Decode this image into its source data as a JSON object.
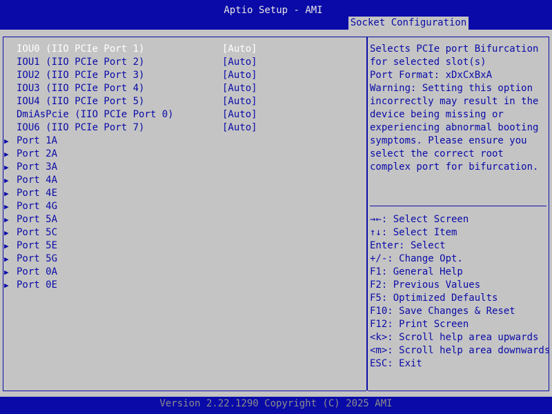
{
  "header": {
    "title": "Aptio Setup - AMI",
    "active_tab": "Socket Configuration"
  },
  "options": [
    {
      "label": "IOU0 (IIO PCIe Port 1)",
      "value": "[Auto]"
    },
    {
      "label": "IOU1 (IIO PCIe Port 2)",
      "value": "[Auto]"
    },
    {
      "label": "IOU2 (IIO PCIe Port 3)",
      "value": "[Auto]"
    },
    {
      "label": "IOU3 (IIO PCIe Port 4)",
      "value": "[Auto]"
    },
    {
      "label": "IOU4 (IIO PCIe Port 5)",
      "value": "[Auto]"
    },
    {
      "label": "DmiAsPcie (IIO PCIe Port 0)",
      "value": "[Auto]"
    },
    {
      "label": "IOU6 (IIO PCIe Port 7)",
      "value": "[Auto]"
    }
  ],
  "submenus": [
    "Port 1A",
    "Port 2A",
    "Port 3A",
    "Port 4A",
    "Port 4E",
    "Port 4G",
    "Port 5A",
    "Port 5C",
    "Port 5E",
    "Port 5G",
    "Port 0A",
    "Port 0E"
  ],
  "submenu_arrow_icon": "right-triangle-icon",
  "help_text": [
    "Selects PCIe port Bifurcation",
    "for selected slot(s)",
    "Port Format: xDxCxBxA",
    "Warning: Setting this option",
    "incorrectly may result in the",
    "device being missing or",
    "experiencing abnormal booting",
    "symptoms. Please ensure you",
    "select the correct root",
    "complex port for bifurcation."
  ],
  "key_help": [
    "→←: Select Screen",
    "↑↓: Select Item",
    "Enter: Select",
    "+/-: Change Opt.",
    "F1: General Help",
    "F2: Previous Values",
    "F5: Optimized Defaults",
    "F10: Save Changes & Reset",
    "F12: Print Screen",
    "<k>: Scroll help area upwards",
    "<m>: Scroll help area downwards",
    "ESC: Exit"
  ],
  "footer": {
    "version": "Version 2.22.1290 Copyright (C) 2025 AMI"
  },
  "colors": {
    "background": "#c4c4c4",
    "bar": "#0a0aa8",
    "text": "#0a0aa8",
    "selected_text": "#ffffff",
    "footer_text": "#8c8c8c"
  }
}
